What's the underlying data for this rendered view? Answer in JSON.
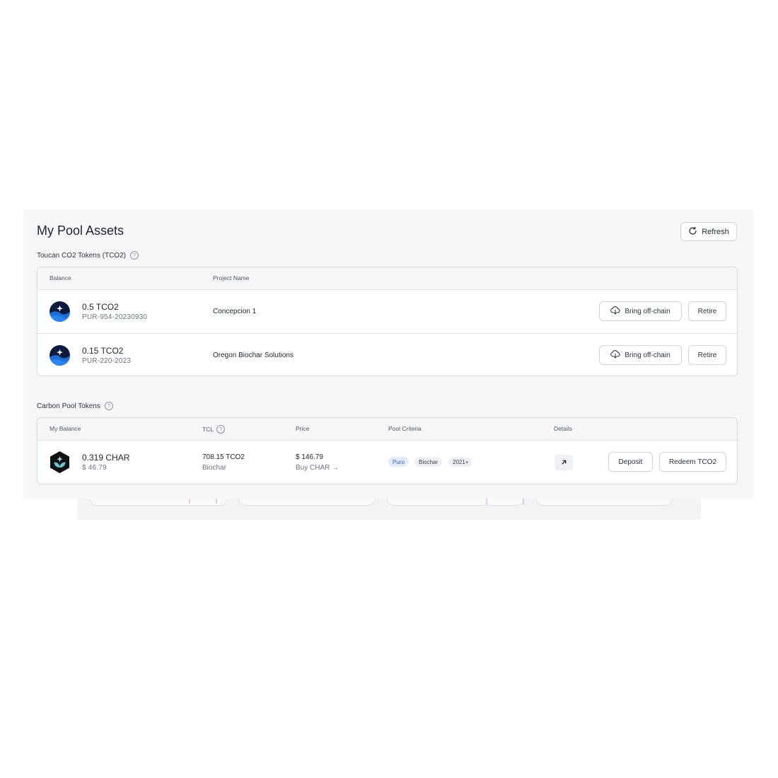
{
  "page": {
    "title": "My Pool Assets",
    "refresh_label": "Refresh"
  },
  "tco2": {
    "section_title": "Toucan CO2 Tokens (TCO2)",
    "columns": {
      "balance": "Balance",
      "project_name": "Project Name"
    },
    "rows": [
      {
        "amount": "0.5 TCO2",
        "id": "PUR-954-20230930",
        "project": "Concepcion 1",
        "offchain_label": "Bring off-chain",
        "retire_label": "Retire"
      },
      {
        "amount": "0.15 TCO2",
        "id": "PUR-220-2023",
        "project": "Oregon Biochar Solutions",
        "offchain_label": "Bring off-chain",
        "retire_label": "Retire"
      }
    ]
  },
  "pool": {
    "section_title": "Carbon Pool Tokens",
    "columns": {
      "my_balance": "My Balance",
      "tcl": "TCL",
      "price": "Price",
      "criteria": "Pool Criteria",
      "details": "Details"
    },
    "rows": [
      {
        "amount": "0.319 CHAR",
        "usd": "$ 46.79",
        "tcl_value": "708.15 TCO2",
        "tcl_sub": "Biochar",
        "price": "$ 146.79",
        "buy_label": "Buy CHAR →",
        "tags": [
          "Puro",
          "Biochar",
          "2021+"
        ],
        "deposit_label": "Deposit",
        "redeem_label": "Redeem TCO2"
      }
    ]
  },
  "icons": {
    "refresh": "refresh-icon",
    "help": "help-circle-icon",
    "cloud_download": "cloud-download-icon",
    "external_link": "arrow-up-right-icon",
    "tco2_token": "tco2-token-icon",
    "char_token": "char-token-icon"
  },
  "colors": {
    "tco2_token_dark": "#0b1b3f",
    "tco2_token_wave": "#1f6fd6",
    "char_token_dark": "#111111",
    "char_token_leaf": "#6fc3d0",
    "tag_blue_bg": "#e4ecfb",
    "tag_blue_text": "#2f5bbf"
  }
}
